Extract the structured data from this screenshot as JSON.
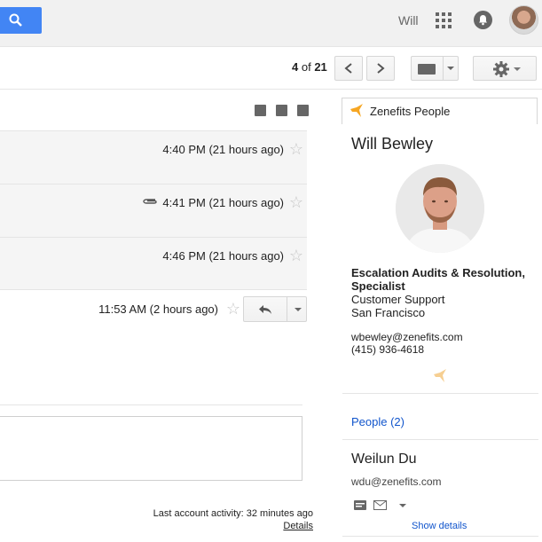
{
  "topbar": {
    "user_name": "Will",
    "icons": [
      "search-icon",
      "apps-grid-icon",
      "notifications-bell-icon",
      "avatar"
    ]
  },
  "toolbar": {
    "pager_current": "4",
    "pager_of": " of ",
    "pager_total": "21"
  },
  "messages": [
    {
      "time": "4:40 PM (21 hours ago)",
      "attachment": false
    },
    {
      "time": "4:41 PM (21 hours ago)",
      "attachment": true
    },
    {
      "time": "4:46 PM (21 hours ago)",
      "attachment": false
    }
  ],
  "expanded_message": {
    "time": "11:53 AM (2 hours ago)"
  },
  "footer": {
    "activity": "Last account activity: 32 minutes ago",
    "details": "Details"
  },
  "sidebar": {
    "tab_label": "Zenefits People",
    "person": {
      "name": "Will Bewley",
      "title": "Escalation Audits & Resolution, Specialist",
      "department": "Customer Support",
      "location": "San Francisco",
      "email": "wbewley@zenefits.com",
      "phone": "(415) 936-4618"
    },
    "people_link": "People (2)",
    "person2": {
      "name": "Weilun Du",
      "email": "wdu@zenefits.com",
      "show_details": "Show details"
    }
  },
  "colors": {
    "accent_blue": "#4285f4",
    "link_blue": "#1155cc",
    "zenefits_orange": "#f6a623"
  }
}
